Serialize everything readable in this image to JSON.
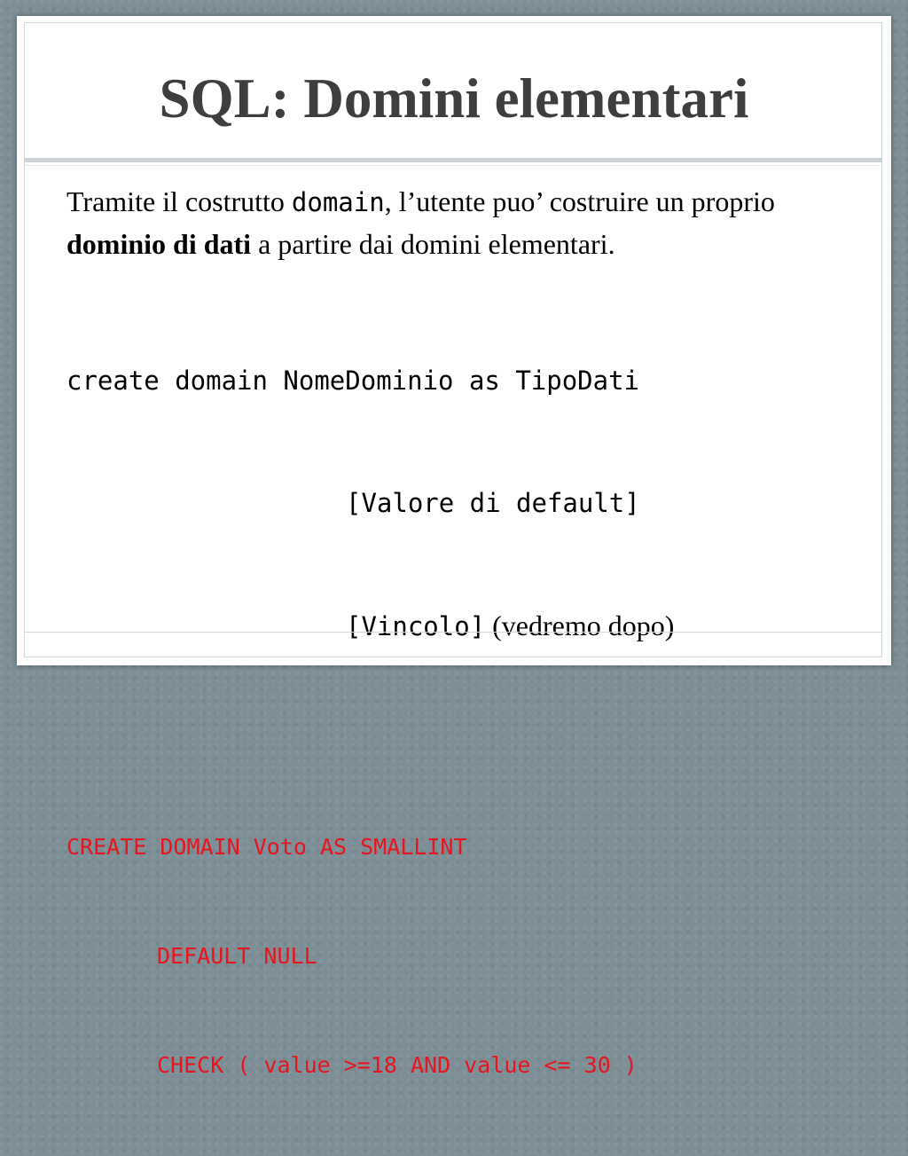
{
  "slide": {
    "title": "SQL: Domini elementari",
    "intro": {
      "part1": "Tramite il costrutto ",
      "keyword": "domain",
      "part2": ", l’utente puo’ costruire un proprio ",
      "bold": "dominio di dati",
      "part3": " a partire dai domini elementari."
    },
    "syntax": {
      "line1": "create domain NomeDominio as TipoDati",
      "line2": "[Valore di default]",
      "line3": "[Vincolo]",
      "line3_note": " (vedremo dopo)"
    },
    "example": {
      "line1": "CREATE DOMAIN Voto AS SMALLINT",
      "line2": "DEFAULT NULL",
      "line3": "CHECK ( value >=18 AND value <= 30 )"
    }
  },
  "colors": {
    "background": "#7d8e96",
    "slide": "#ffffff",
    "title": "#3e3e3e",
    "example_code": "#e8141e"
  }
}
